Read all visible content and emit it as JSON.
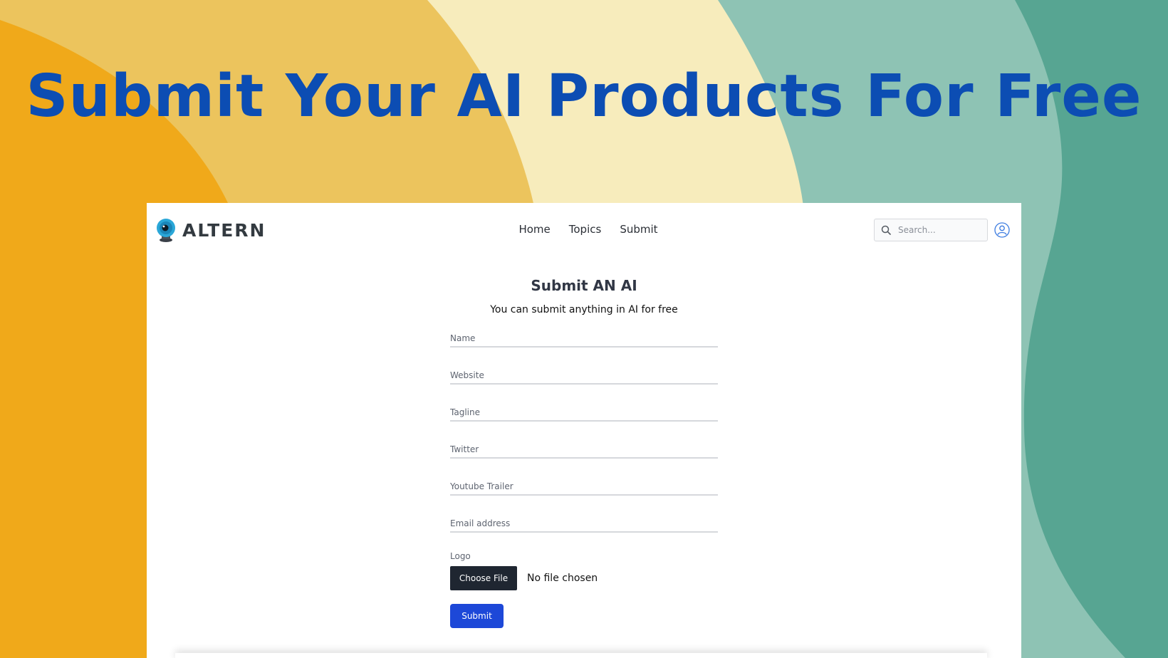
{
  "colors": {
    "headline": "#0c4db3",
    "orange": "#f0a91a",
    "gold": "#ecc45d",
    "cream": "#f7ecbc",
    "light_teal": "#8ec3b4",
    "teal": "#57a592",
    "submit_button": "#1d48d8",
    "choose_file_button": "#1f2631"
  },
  "headline": "Submit Your AI Products For Free",
  "navbar": {
    "logo_text": "ALTERN",
    "logo_icon": "camera-lens-icon",
    "links": [
      "Home",
      "Topics",
      "Submit"
    ],
    "search_placeholder": "Search...",
    "search_icon": "search-icon",
    "user_icon": "user-circle-icon"
  },
  "form": {
    "title": "Submit AN AI",
    "subtitle": "You can submit anything in AI for free",
    "fields": [
      {
        "placeholder": "Name"
      },
      {
        "placeholder": "Website"
      },
      {
        "placeholder": "Tagline"
      },
      {
        "placeholder": "Twitter"
      },
      {
        "placeholder": "Youtube Trailer"
      },
      {
        "placeholder": "Email address"
      }
    ],
    "logo_label": "Logo",
    "choose_file_label": "Choose File",
    "no_file_text": "No file chosen",
    "submit_label": "Submit"
  }
}
